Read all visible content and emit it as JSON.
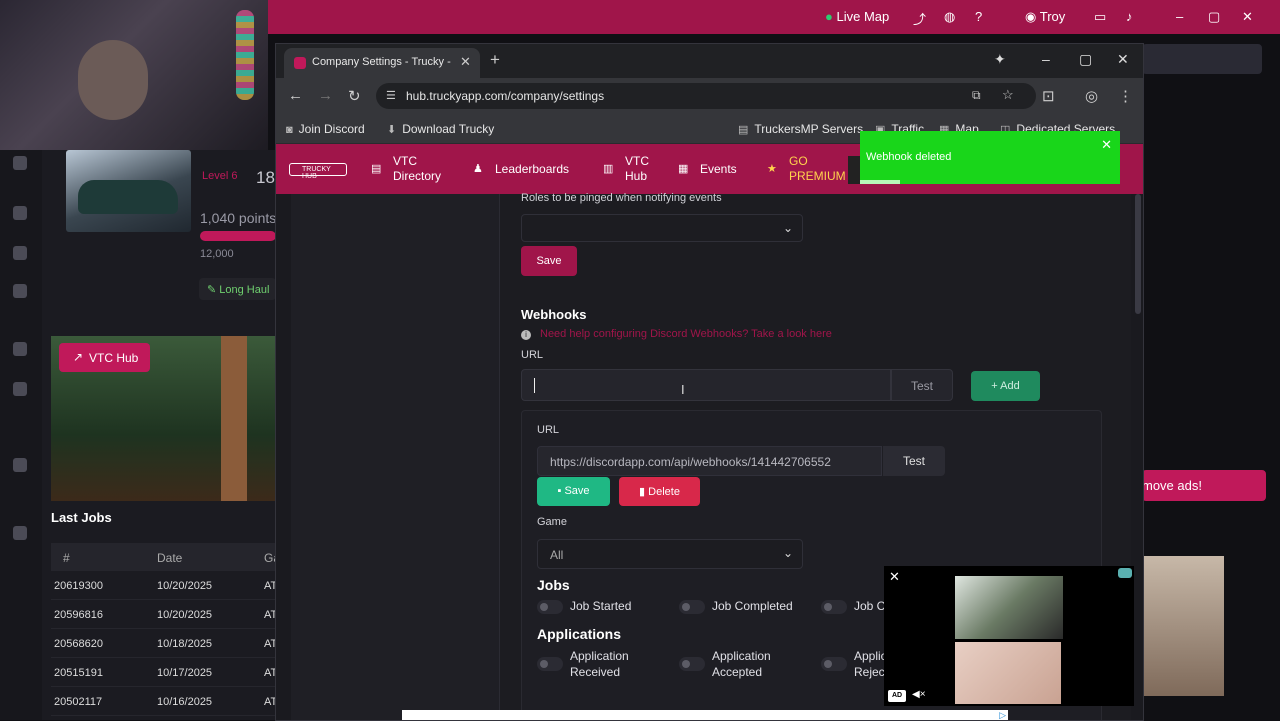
{
  "background_app": {
    "topbar": {
      "live_map": "Live Map",
      "user": "Troy"
    },
    "profile": {
      "level_badge": "Level 6",
      "level_value": "18,",
      "points": "1,040 points",
      "points_max": "12,000",
      "badge": "Long Haul"
    },
    "vtc_hub_button": "VTC Hub",
    "last_jobs": {
      "title": "Last Jobs",
      "columns": [
        "#",
        "Date",
        "Ga"
      ],
      "rows": [
        [
          "20619300",
          "10/20/2025",
          "AT"
        ],
        [
          "20596816",
          "10/20/2025",
          "AT"
        ],
        [
          "20568620",
          "10/18/2025",
          "AT"
        ],
        [
          "20515191",
          "10/17/2025",
          "AT"
        ],
        [
          "20502117",
          "10/16/2025",
          "AT"
        ]
      ]
    },
    "remove_ads": "move ads!"
  },
  "browser": {
    "tab_title": "Company Settings - Trucky - The",
    "url": "hub.truckyapp.com/company/settings",
    "bookmarks": [
      {
        "label": "Join Discord",
        "icon": "discord-icon"
      },
      {
        "label": "Download Trucky",
        "icon": "download-icon"
      },
      {
        "label": "TruckersMP Servers",
        "icon": "server-icon"
      },
      {
        "label": "Traffic",
        "icon": "truck-icon"
      },
      {
        "label": "Map",
        "icon": "map-icon"
      },
      {
        "label": "Dedicated Servers",
        "icon": "server-icon"
      }
    ]
  },
  "site_nav": {
    "logo": "TRUCKY HUB",
    "vtc_directory": "VTC\nDirectory",
    "leaderboards": "Leaderboards",
    "vtc_hub": "VTC\nHub",
    "events": "Events",
    "go_premium": "GO\nPREMIUM"
  },
  "settings": {
    "roles_label": "Roles to be pinged when notifying events",
    "roles_save": "Save",
    "webhooks_title": "Webhooks",
    "help_link": "Need help configuring Discord Webhooks? Take a look here",
    "url_label": "URL",
    "url_input_value": "",
    "test_button": "Test",
    "add_button": "+ Add",
    "hook": {
      "url_label": "URL",
      "url_value": "https://discordapp.com/api/webhooks/141442706552",
      "test_button": "Test",
      "save_button": "Save",
      "delete_button": "Delete",
      "game_label": "Game",
      "game_value": "All",
      "jobs_title": "Jobs",
      "job_toggles": [
        "Job Started",
        "Job Completed",
        "Job C"
      ],
      "applications_title": "Applications",
      "app_toggles": [
        "Application\nReceived",
        "Application\nAccepted",
        "Applic\nRejec"
      ]
    }
  },
  "toast": {
    "message": "Webhook deleted",
    "color": "#19d61a"
  },
  "colors": {
    "brand": "#a0154a",
    "success": "#1fb884",
    "danger": "#d8284a"
  }
}
